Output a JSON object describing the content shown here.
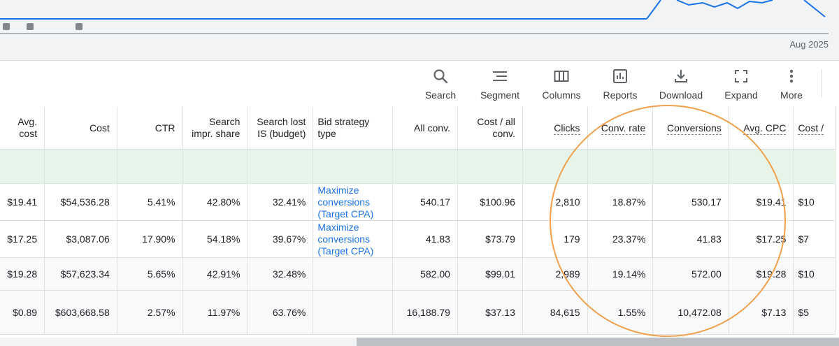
{
  "chart": {
    "period_label": "Aug 2025",
    "line_color": "#1a73e8"
  },
  "toolbar": {
    "items": [
      {
        "label": "Search",
        "icon": "search-icon"
      },
      {
        "label": "Segment",
        "icon": "segment-icon"
      },
      {
        "label": "Columns",
        "icon": "columns-icon"
      },
      {
        "label": "Reports",
        "icon": "reports-icon"
      },
      {
        "label": "Download",
        "icon": "download-icon"
      },
      {
        "label": "Expand",
        "icon": "expand-icon"
      },
      {
        "label": "More",
        "icon": "more-vert-icon"
      }
    ]
  },
  "table": {
    "headers": {
      "avg_cost": "Avg. cost",
      "cost": "Cost",
      "ctr": "CTR",
      "search_impr_share_1": "Search",
      "search_impr_share_2": "impr. share",
      "search_lost_1": "Search lost",
      "search_lost_2": "IS (budget)",
      "bid_strategy_1": "Bid strategy",
      "bid_strategy_2": "type",
      "all_conv": "All conv.",
      "cost_all_conv_1": "Cost / all",
      "cost_all_conv_2": "conv.",
      "clicks": "Clicks",
      "conv_rate": "Conv. rate",
      "conversions": "Conversions",
      "avg_cpc": "Avg. CPC",
      "cost_per": "Cost / "
    },
    "rows": [
      {
        "avg_cost": "$19.41",
        "cost": "$54,536.28",
        "ctr": "5.41%",
        "impr_share": "42.80%",
        "lost_is": "32.41%",
        "bid_1": "Maximize",
        "bid_2": "conversions",
        "bid_3": "(Target CPA)",
        "all_conv": "540.17",
        "cost_all_conv": "$100.96",
        "clicks": "2,810",
        "conv_rate": "18.87%",
        "conversions": "530.17",
        "avg_cpc": "$19.41",
        "cost_per": "$10"
      },
      {
        "avg_cost": "$17.25",
        "cost": "$3,087.06",
        "ctr": "17.90%",
        "impr_share": "54.18%",
        "lost_is": "39.67%",
        "bid_1": "Maximize",
        "bid_2": "conversions",
        "bid_3": "(Target CPA)",
        "all_conv": "41.83",
        "cost_all_conv": "$73.79",
        "clicks": "179",
        "conv_rate": "23.37%",
        "conversions": "41.83",
        "avg_cpc": "$17.25",
        "cost_per": "$7"
      },
      {
        "avg_cost": "$19.28",
        "cost": "$57,623.34",
        "ctr": "5.65%",
        "impr_share": "42.91%",
        "lost_is": "32.48%",
        "all_conv": "582.00",
        "cost_all_conv": "$99.01",
        "clicks": "2,989",
        "conv_rate": "19.14%",
        "conversions": "572.00",
        "avg_cpc": "$19.28",
        "cost_per": "$10"
      },
      {
        "avg_cost": "$0.89",
        "cost": "$603,668.58",
        "ctr": "2.57%",
        "impr_share": "11.97%",
        "lost_is": "63.76%",
        "all_conv": "16,188.79",
        "cost_all_conv": "$37.13",
        "clicks": "84,615",
        "conv_rate": "1.55%",
        "conversions": "10,472.08",
        "avg_cpc": "$7.13",
        "cost_per": "$5"
      }
    ]
  },
  "annotation": {
    "color": "#f0a04b"
  }
}
